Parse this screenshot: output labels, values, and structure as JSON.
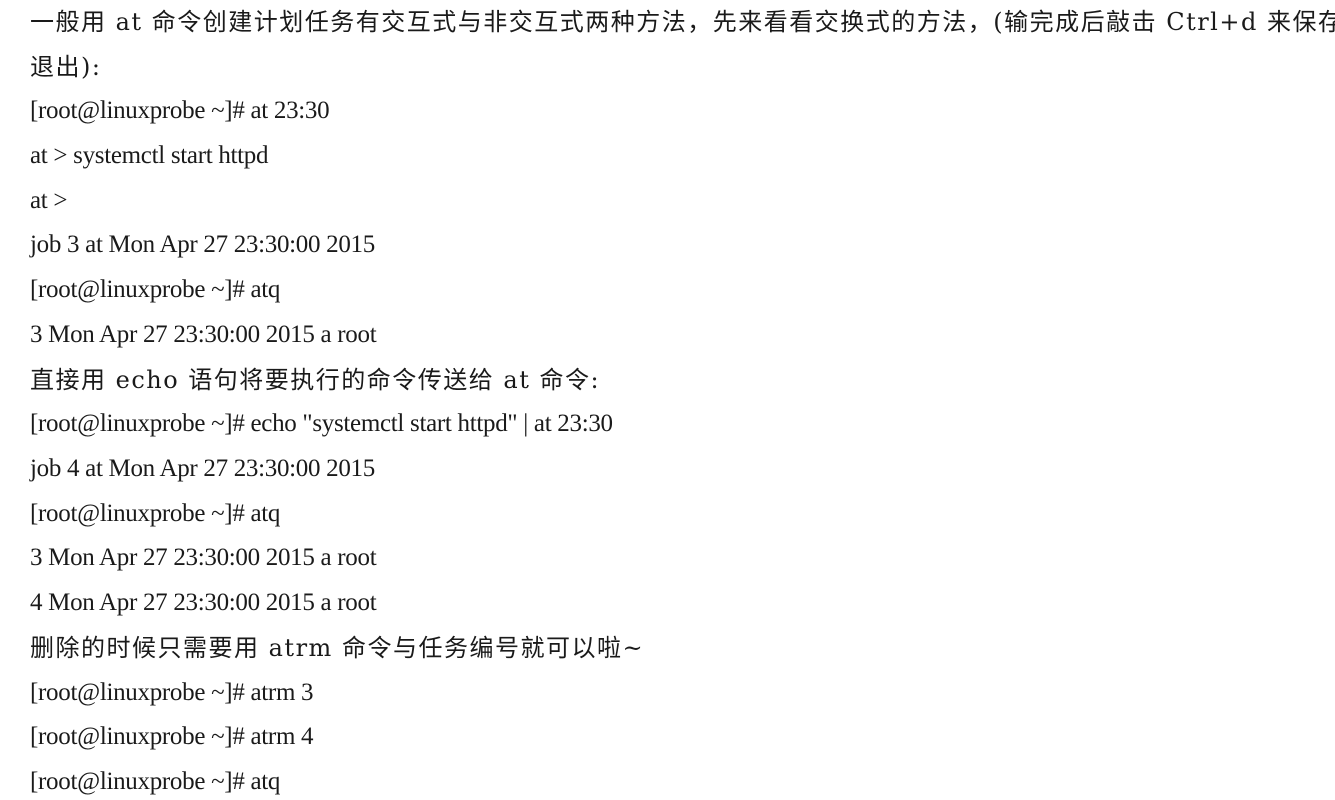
{
  "lines": [
    "一般用 at 命令创建计划任务有交互式与非交互式两种方法，先来看看交换式的方法，(输完成后敲击 Ctrl+d 来保存",
    "退出):",
    "[root@linuxprobe ~]# at 23:30",
    "at > systemctl start httpd",
    "at >",
    "job 3 at Mon Apr 27 23:30:00 2015",
    "[root@linuxprobe ~]# atq",
    "3 Mon Apr 27 23:30:00 2015 a root",
    "直接用 echo 语句将要执行的命令传送给 at 命令:",
    "[root@linuxprobe ~]# echo \"systemctl start httpd\" | at 23:30",
    "job 4 at Mon Apr 27 23:30:00 2015",
    "[root@linuxprobe ~]# atq",
    "3 Mon Apr 27 23:30:00 2015 a root",
    "4 Mon Apr 27 23:30:00 2015 a root",
    "删除的时候只需要用 atrm 命令与任务编号就可以啦~",
    "[root@linuxprobe ~]# atrm 3",
    "[root@linuxprobe ~]# atrm 4",
    "[root@linuxprobe ~]# atq"
  ]
}
